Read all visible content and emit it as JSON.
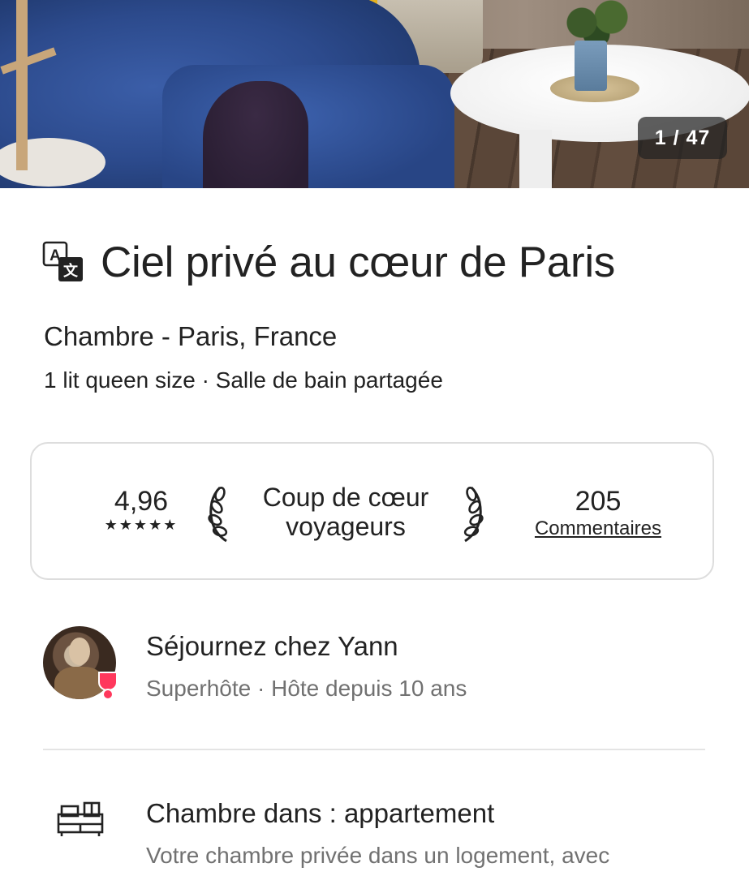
{
  "gallery": {
    "counter": "1 / 47"
  },
  "listing": {
    "title": "Ciel privé au cœur de Paris",
    "subtitle": "Chambre - Paris, France",
    "details": "1 lit queen size · Salle de bain partagée"
  },
  "rating_card": {
    "score": "4,96",
    "stars": "★★★★★",
    "badge_line1": "Coup de cœur",
    "badge_line2": "voyageurs",
    "reviews_count": "205",
    "reviews_label": "Commentaires"
  },
  "host": {
    "title": "Séjournez chez Yann",
    "subtitle": "Superhôte · Hôte depuis 10 ans"
  },
  "room": {
    "title": "Chambre dans : appartement",
    "description": "Votre chambre privée dans un logement, avec"
  },
  "colors": {
    "text": "#222222",
    "secondary_text": "#717171",
    "superhost_accent": "#ff385c",
    "border": "#dddddd"
  }
}
